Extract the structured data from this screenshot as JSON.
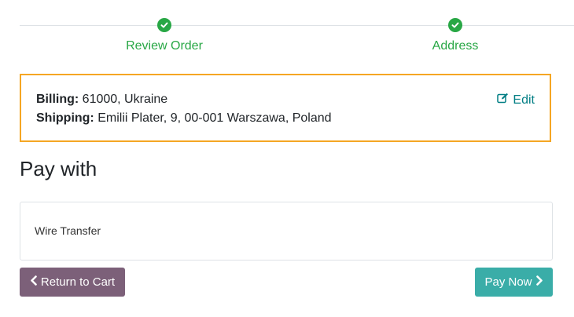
{
  "wizard": {
    "steps": [
      {
        "label": "Review Order",
        "icon": "check-circle-icon",
        "status": "done"
      },
      {
        "label": "Address",
        "icon": "check-circle-icon",
        "status": "done"
      }
    ],
    "color": "#28a745"
  },
  "address": {
    "billing_label": "Billing:",
    "billing_value": "61000, Ukraine",
    "shipping_label": "Shipping:",
    "shipping_value": "Emilii Plater, 9, 00-001 Warszawa, Poland",
    "edit_label": "Edit",
    "edit_icon": "pencil-square-icon",
    "border_color": "#f5a623"
  },
  "payment": {
    "heading": "Pay with",
    "options": [
      {
        "label": "Wire Transfer"
      }
    ]
  },
  "actions": {
    "return_label": "Return to Cart",
    "return_icon": "chevron-left-icon",
    "return_color": "#7c6079",
    "pay_label": "Pay Now",
    "pay_icon": "chevron-right-icon",
    "pay_color": "#3aada8"
  }
}
